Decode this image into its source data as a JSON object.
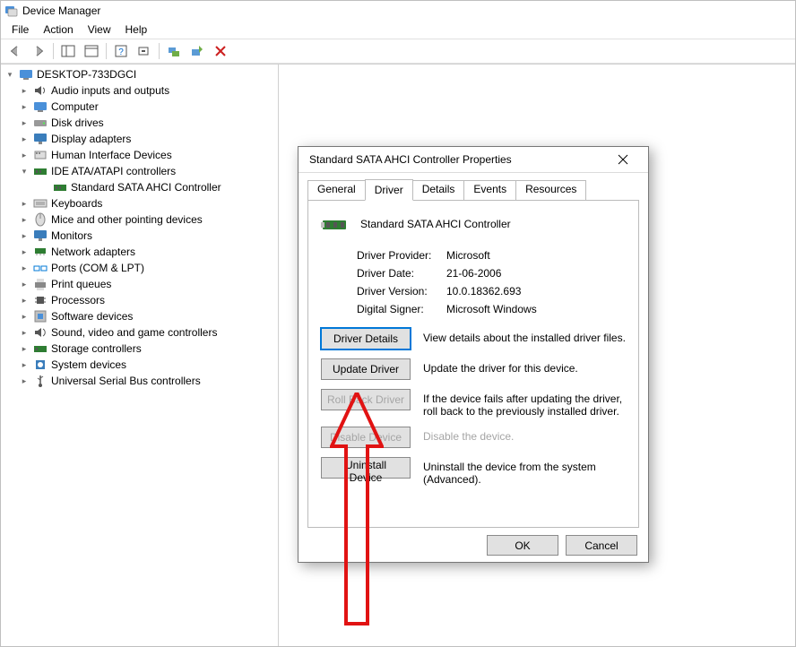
{
  "app": {
    "title": "Device Manager"
  },
  "menu": {
    "file": "File",
    "action": "Action",
    "view": "View",
    "help": "Help"
  },
  "tree": {
    "root": "DESKTOP-733DGCI",
    "items": [
      {
        "label": "Audio inputs and outputs",
        "expanded": false
      },
      {
        "label": "Computer",
        "expanded": false
      },
      {
        "label": "Disk drives",
        "expanded": false
      },
      {
        "label": "Display adapters",
        "expanded": false
      },
      {
        "label": "Human Interface Devices",
        "expanded": false
      },
      {
        "label": "IDE ATA/ATAPI controllers",
        "expanded": true,
        "children": [
          {
            "label": "Standard SATA AHCI Controller"
          }
        ]
      },
      {
        "label": "Keyboards",
        "expanded": false
      },
      {
        "label": "Mice and other pointing devices",
        "expanded": false
      },
      {
        "label": "Monitors",
        "expanded": false
      },
      {
        "label": "Network adapters",
        "expanded": false
      },
      {
        "label": "Ports (COM & LPT)",
        "expanded": false
      },
      {
        "label": "Print queues",
        "expanded": false
      },
      {
        "label": "Processors",
        "expanded": false
      },
      {
        "label": "Software devices",
        "expanded": false
      },
      {
        "label": "Sound, video and game controllers",
        "expanded": false
      },
      {
        "label": "Storage controllers",
        "expanded": false
      },
      {
        "label": "System devices",
        "expanded": false
      },
      {
        "label": "Universal Serial Bus controllers",
        "expanded": false
      }
    ]
  },
  "dialog": {
    "title": "Standard SATA AHCI Controller Properties",
    "device_name": "Standard SATA AHCI Controller",
    "tabs": {
      "general": "General",
      "driver": "Driver",
      "details": "Details",
      "events": "Events",
      "resources": "Resources"
    },
    "info": {
      "provider_label": "Driver Provider:",
      "provider_value": "Microsoft",
      "date_label": "Driver Date:",
      "date_value": "21-06-2006",
      "version_label": "Driver Version:",
      "version_value": "10.0.18362.693",
      "signer_label": "Digital Signer:",
      "signer_value": "Microsoft Windows"
    },
    "buttons": {
      "details": {
        "label": "Driver Details",
        "desc": "View details about the installed driver files."
      },
      "update": {
        "label": "Update Driver",
        "desc": "Update the driver for this device."
      },
      "rollback": {
        "label": "Roll Back Driver",
        "desc": "If the device fails after updating the driver, roll back to the previously installed driver."
      },
      "disable": {
        "label": "Disable Device",
        "desc": "Disable the device."
      },
      "uninstall": {
        "label": "Uninstall Device",
        "desc": "Uninstall the device from the system (Advanced)."
      }
    },
    "footer": {
      "ok": "OK",
      "cancel": "Cancel"
    }
  }
}
